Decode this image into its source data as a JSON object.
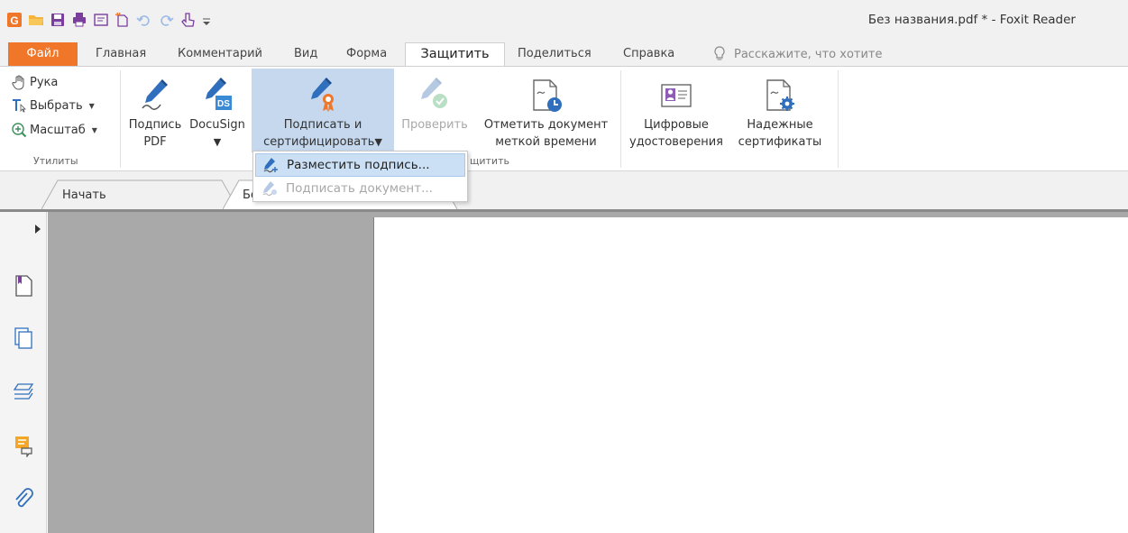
{
  "window": {
    "title": "Без названия.pdf * - Foxit Reader"
  },
  "quick_access": [
    {
      "name": "foxit-logo-icon"
    },
    {
      "name": "open-folder-icon"
    },
    {
      "name": "save-icon"
    },
    {
      "name": "print-icon"
    },
    {
      "name": "properties-icon"
    },
    {
      "name": "new-icon"
    },
    {
      "name": "undo-icon"
    },
    {
      "name": "redo-icon"
    },
    {
      "name": "touch-mode-icon"
    },
    {
      "name": "customize-icon"
    }
  ],
  "menu_tabs": [
    {
      "label": "Файл"
    },
    {
      "label": "Главная"
    },
    {
      "label": "Комментарий"
    },
    {
      "label": "Вид"
    },
    {
      "label": "Форма"
    },
    {
      "label": "Защитить"
    },
    {
      "label": "Поделиться"
    },
    {
      "label": "Справка"
    }
  ],
  "tell_me": {
    "placeholder": "Расскажите, что хотите"
  },
  "ribbon": {
    "utilities": {
      "hand": "Рука",
      "select": "Выбрать",
      "zoom": "Масштаб",
      "group_label": "Утилиты"
    },
    "sign_pdf": {
      "line1": "Подпись",
      "line2": "PDF"
    },
    "docusign": {
      "line1": "DocuSign"
    },
    "sign_certify": {
      "line1": "Подписать и",
      "line2": "сертифицировать"
    },
    "verify": {
      "line1": "Проверить"
    },
    "timestamp": {
      "line1": "Отметить документ",
      "line2": "меткой времени"
    },
    "protect_group_label": "щитить",
    "digital_ids": {
      "line1": "Цифровые",
      "line2": "удостоверения"
    },
    "trusted_certs": {
      "line1": "Надежные",
      "line2": "сертификаты"
    }
  },
  "dropdown": {
    "place_signature": "Разместить подпись...",
    "sign_document": "Подписать документ..."
  },
  "doc_tabs": [
    {
      "label": "Начать"
    },
    {
      "label": "Без названия.pdf"
    }
  ],
  "sidebar": [
    {
      "name": "bookmarks-icon"
    },
    {
      "name": "pages-icon"
    },
    {
      "name": "layers-icon"
    },
    {
      "name": "comments-icon"
    },
    {
      "name": "attachments-icon"
    }
  ],
  "colors": {
    "file_tab": "#f0762a",
    "accent_blue": "#2f6fbd",
    "pressed_bg": "#c5d8ee",
    "doc_bg": "#a9a9a9"
  }
}
